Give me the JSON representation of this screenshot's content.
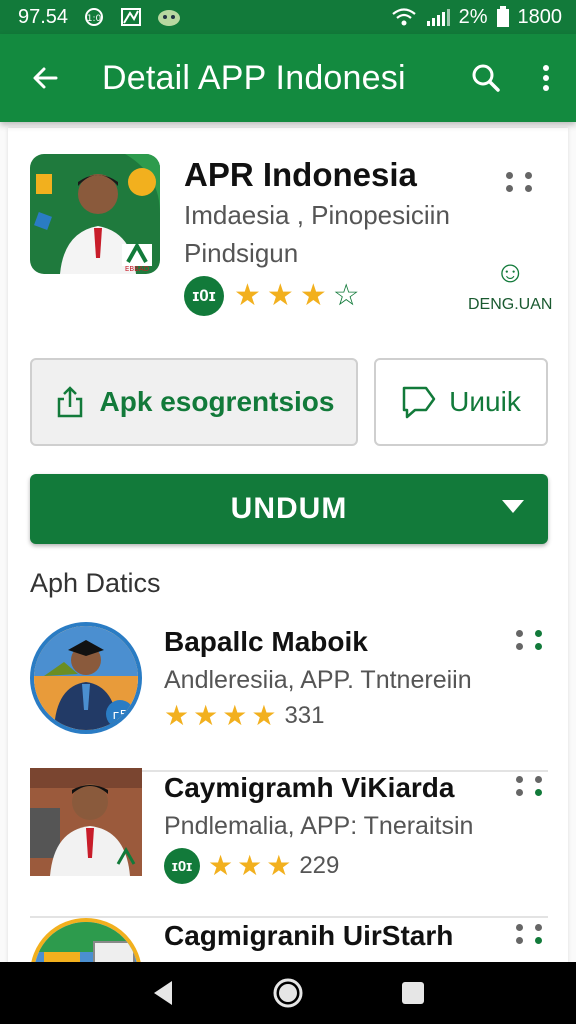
{
  "status": {
    "time": "97.54",
    "battery_pct": "2%",
    "clock": "1800"
  },
  "appbar": {
    "title": "Detail APP Indonesi"
  },
  "app": {
    "name": "APR Indonesia",
    "subtitle1": "Imdaesia , Pinopesiciin",
    "subtitle2": "Pindsigun",
    "badge": "ɪ0ɪ",
    "rating": 3,
    "rating_max": 4,
    "developer_label": "DENG.UAN",
    "icon_badge_text": "EBBAD"
  },
  "actions": {
    "share_label": "Apk esogrentsios",
    "secondary_label": "Uиuik",
    "primary_label": "UNDUM"
  },
  "section": {
    "title": "Aph Datics"
  },
  "list": [
    {
      "name": "Bapallc Maboik",
      "subtitle": "Andleresiia, APP. Tntnereiin",
      "rating": 4,
      "count": "331"
    },
    {
      "name": "Caymigramh ViKiarda",
      "subtitle": "Pndlemalia, APP: Tneraitsin",
      "badge": "ɪ0ɪ",
      "rating": 3,
      "count": "229"
    },
    {
      "name": "Cagmigranih UirStarh"
    }
  ],
  "colors": {
    "primary": "#138a3f",
    "status_bar": "#127a3a",
    "star": "#f2b01e"
  }
}
